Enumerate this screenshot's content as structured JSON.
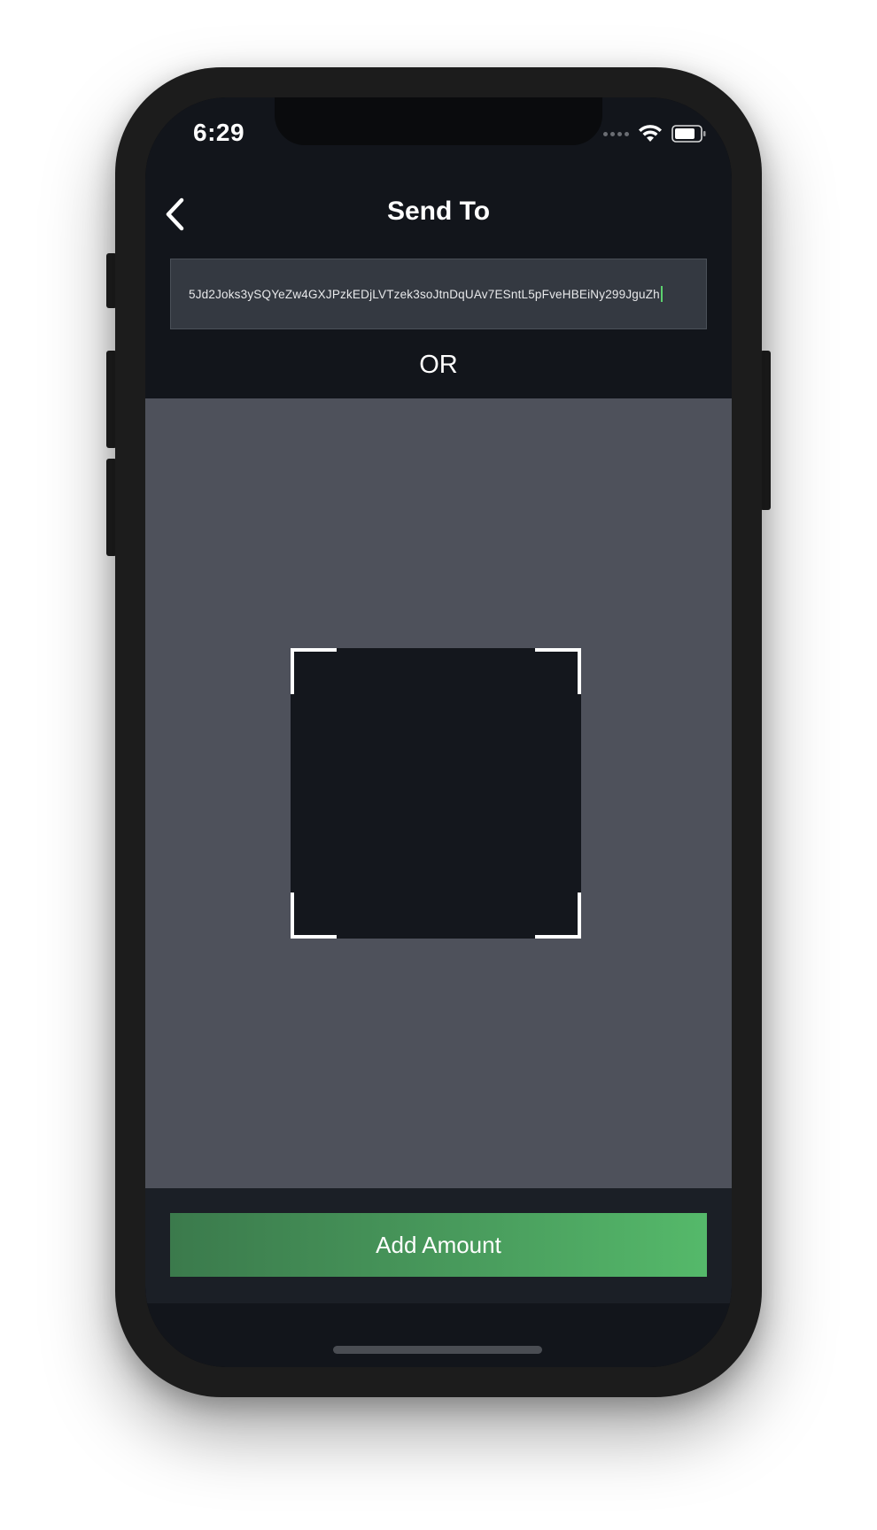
{
  "status_bar": {
    "time": "6:29"
  },
  "nav": {
    "title": "Send To",
    "back_icon": "chevron-left-icon"
  },
  "address_field": {
    "value": "5Jd2Joks3ySQYeZw4GXJPzkEDjLVTzek3soJtnDqUAv7ESntL5pFveHBEiNy299JguZh"
  },
  "divider": {
    "or_label": "OR"
  },
  "scanner": {
    "frame_icon": "qr-scan-frame-icon"
  },
  "footer": {
    "add_amount_label": "Add Amount"
  },
  "colors": {
    "background": "#12151b",
    "scanner_bg": "#4e515b",
    "input_bg": "#343941",
    "accent_green": "#4a9e5e",
    "caret": "#5cd26e"
  }
}
